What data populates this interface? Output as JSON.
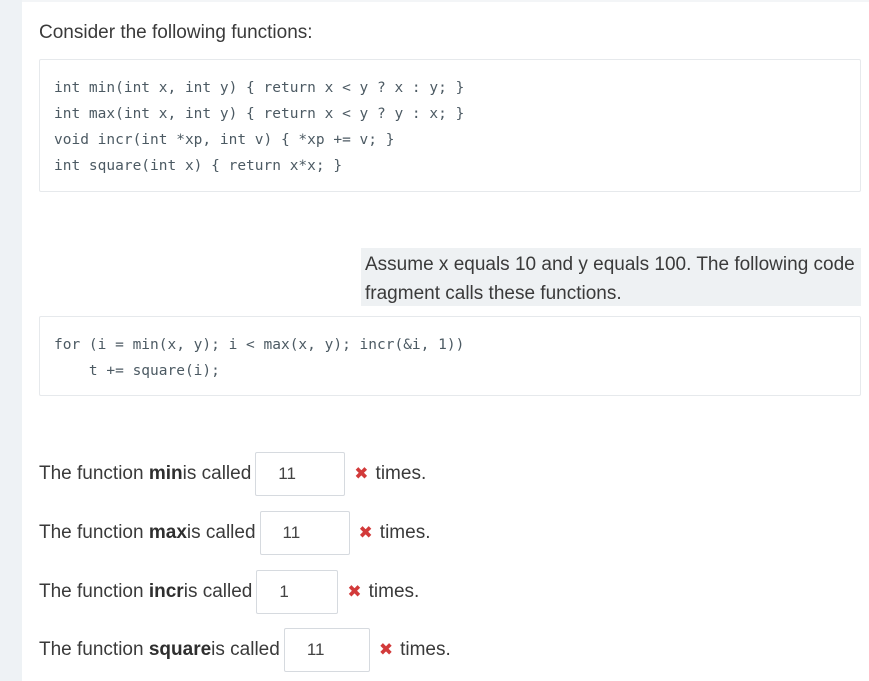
{
  "intro": "Consider the following functions:",
  "code_functions": [
    "int min(int x, int y) { return x < y ? x : y; }",
    "int max(int x, int y) { return x < y ? y : x; }",
    "void incr(int *xp, int v) { *xp += v; }",
    "int square(int x) { return x*x; }"
  ],
  "assume_text": "Assume x equals 10 and y equals 100. The following code fragment calls these functions.",
  "code_loop": [
    "for (i = min(x, y); i < max(x, y); incr(&i, 1))",
    "    t += square(i);"
  ],
  "questions": [
    {
      "prefix": "The function ",
      "fn": "min",
      "suffix": " is called",
      "answer": "11",
      "feedback": "✖",
      "unit": "times."
    },
    {
      "prefix": "The function ",
      "fn": "max",
      "suffix": " is called",
      "answer": "11",
      "feedback": "✖",
      "unit": "times."
    },
    {
      "prefix": "The function ",
      "fn": "incr",
      "suffix": " is called",
      "answer": "1",
      "feedback": "✖",
      "unit": "times."
    },
    {
      "prefix": "The function ",
      "fn": "square",
      "suffix": " is called",
      "answer": "11",
      "feedback": "✖",
      "unit": "times."
    }
  ],
  "colors": {
    "incorrect": "#d23a3a",
    "code_text": "#4c5a63",
    "highlight_bg": "#eef1f3"
  }
}
